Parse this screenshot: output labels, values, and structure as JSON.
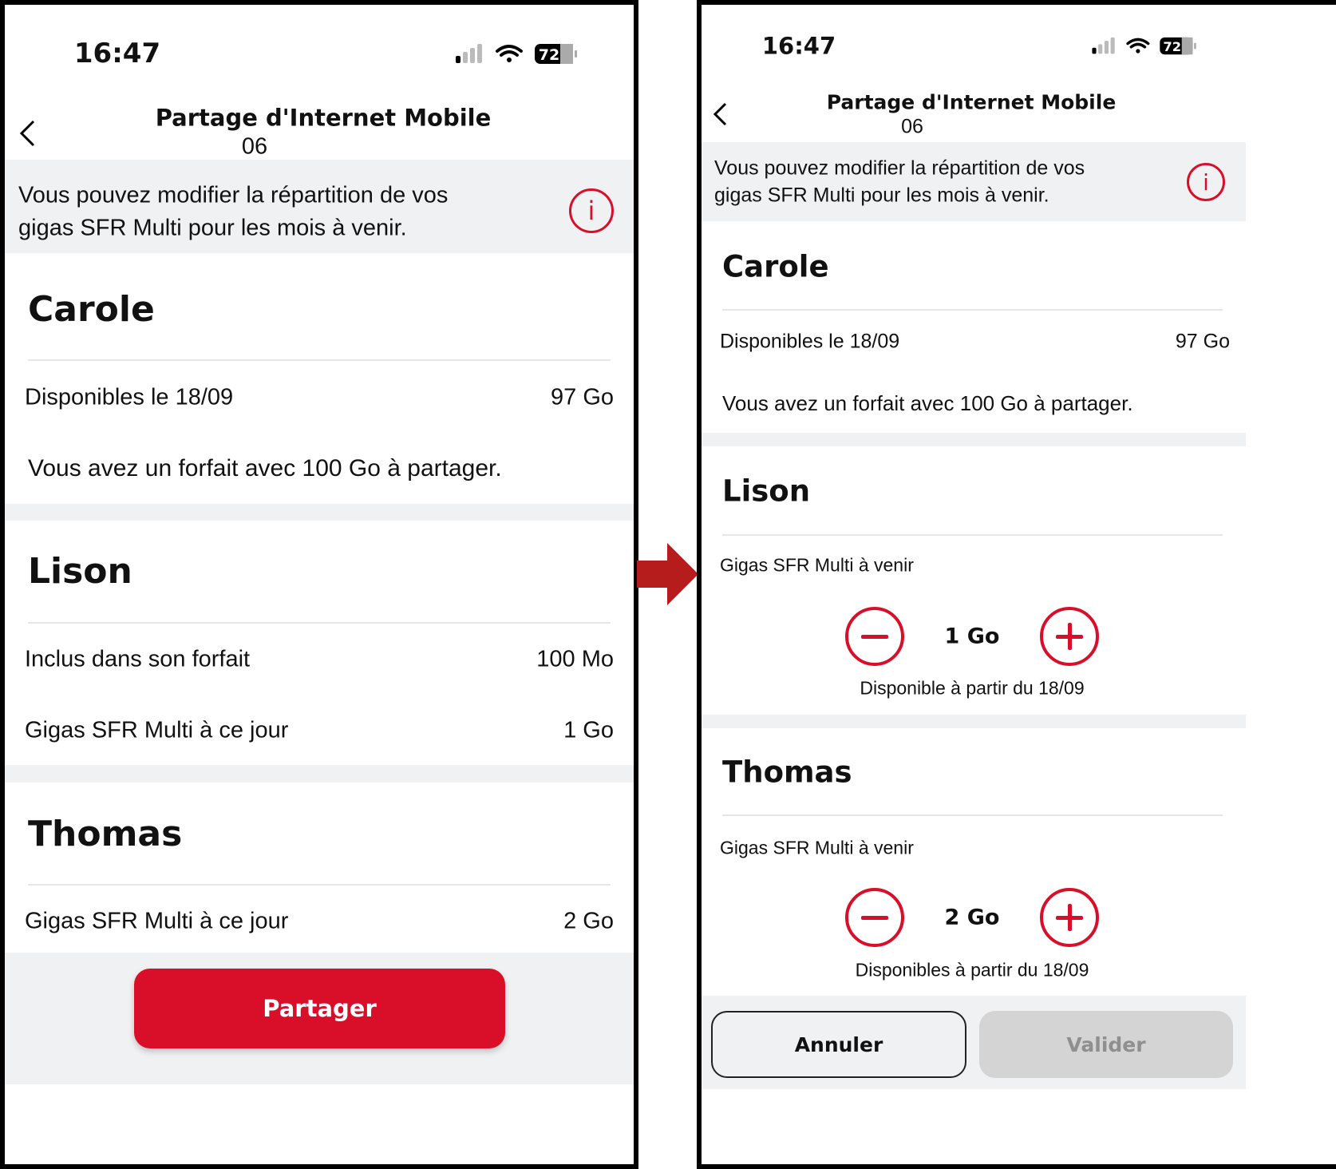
{
  "colors": {
    "brand_red": "#d90f2a",
    "arrow_red": "#b71c1c",
    "band_gray": "#f0f1f3",
    "disabled_gray": "#d4d4d4"
  },
  "before": {
    "status": {
      "time": "16:47",
      "battery": "72",
      "icons": [
        "signal-icon",
        "wifi-icon",
        "battery-icon"
      ]
    },
    "header": {
      "title": "Partage d'Internet Mobile",
      "subtitle": "06",
      "back_icon": "chevron-left-icon"
    },
    "info": {
      "text_line1": "Vous pouvez modifier la répartition de vos",
      "text_line2": "gigas SFR Multi pour les mois à venir.",
      "icon": "info-icon"
    },
    "carole": {
      "name": "Carole",
      "row_label": "Disponibles le 18/09",
      "row_value": "97 Go",
      "note": "Vous avez un forfait avec 100 Go à partager."
    },
    "lison": {
      "name": "Lison",
      "rows": [
        {
          "label": "Inclus dans son forfait",
          "value": "100 Mo"
        },
        {
          "label": "Gigas SFR Multi à ce jour",
          "value": "1 Go"
        }
      ]
    },
    "thomas": {
      "name": "Thomas",
      "rows": [
        {
          "label": "Gigas SFR Multi à ce jour",
          "value": "2 Go"
        }
      ]
    },
    "share_button": "Partager"
  },
  "after": {
    "status": {
      "time": "16:47",
      "battery": "72"
    },
    "header": {
      "title": "Partage d'Internet Mobile",
      "subtitle": "06"
    },
    "info": {
      "text_line1": "Vous pouvez modifier la répartition de vos",
      "text_line2": "gigas SFR Multi pour les mois à venir."
    },
    "carole": {
      "name": "Carole",
      "row_label": "Disponibles le 18/09",
      "row_value": "97 Go",
      "note": "Vous avez un forfait avec 100 Go à partager."
    },
    "lison": {
      "name": "Lison",
      "label": "Gigas SFR Multi à venir",
      "value": "1 Go",
      "availability": "Disponible à partir du 18/09"
    },
    "thomas": {
      "name": "Thomas",
      "label": "Gigas SFR Multi à venir",
      "value": "2 Go",
      "availability": "Disponibles à partir du 18/09"
    },
    "cancel_button": "Annuler",
    "validate_button": "Valider",
    "validate_enabled": false
  }
}
